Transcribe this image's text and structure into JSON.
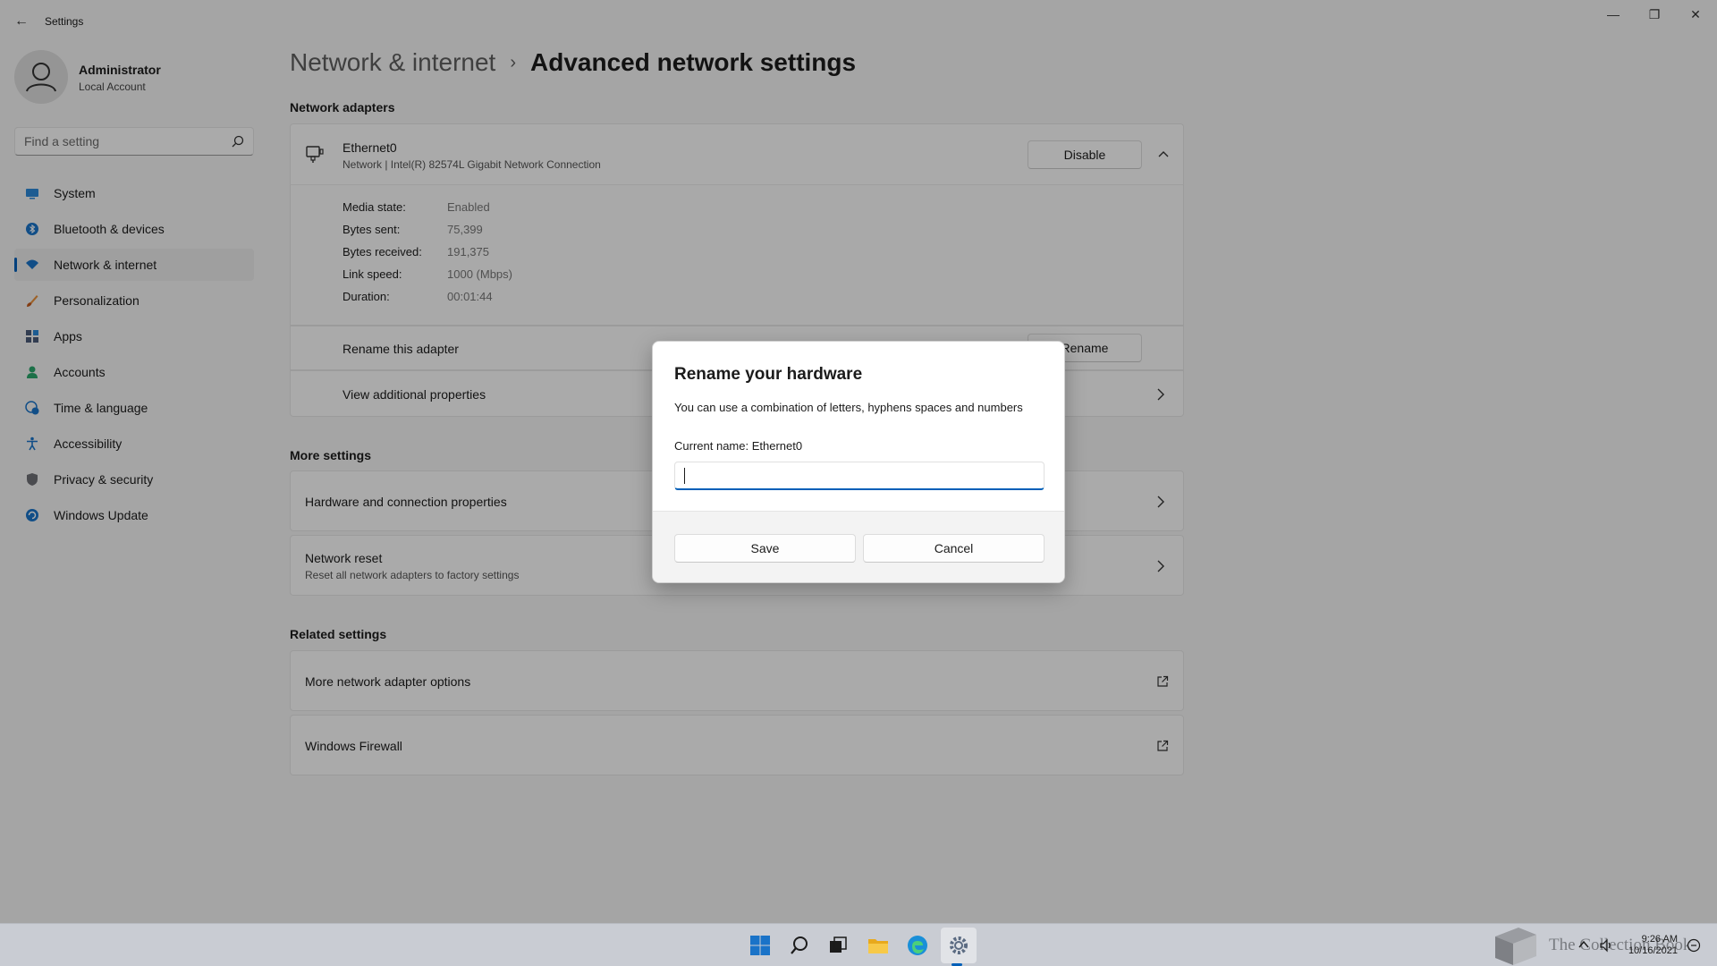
{
  "window": {
    "title": "Settings",
    "back_glyph": "←",
    "minimize_glyph": "—",
    "maximize_glyph": "❐",
    "close_glyph": "✕"
  },
  "profile": {
    "name": "Administrator",
    "account_type": "Local Account"
  },
  "search": {
    "placeholder": "Find a setting"
  },
  "sidebar": {
    "items": [
      {
        "label": "System",
        "icon": "system-icon",
        "active": false
      },
      {
        "label": "Bluetooth & devices",
        "icon": "bluetooth-icon",
        "active": false
      },
      {
        "label": "Network & internet",
        "icon": "wifi-icon",
        "active": true
      },
      {
        "label": "Personalization",
        "icon": "brush-icon",
        "active": false
      },
      {
        "label": "Apps",
        "icon": "apps-icon",
        "active": false
      },
      {
        "label": "Accounts",
        "icon": "person-icon",
        "active": false
      },
      {
        "label": "Time & language",
        "icon": "globe-clock-icon",
        "active": false
      },
      {
        "label": "Accessibility",
        "icon": "accessibility-icon",
        "active": false
      },
      {
        "label": "Privacy & security",
        "icon": "shield-icon",
        "active": false
      },
      {
        "label": "Windows Update",
        "icon": "update-icon",
        "active": false
      }
    ]
  },
  "breadcrumb": {
    "parent": "Network & internet",
    "separator": "›",
    "current": "Advanced network settings"
  },
  "network_adapters": {
    "section_title": "Network adapters",
    "adapter": {
      "name": "Ethernet0",
      "description": "Network | Intel(R) 82574L Gigabit Network Connection",
      "disable_label": "Disable",
      "details": [
        {
          "label": "Media state:",
          "value": "Enabled"
        },
        {
          "label": "Bytes sent:",
          "value": "75,399"
        },
        {
          "label": "Bytes received:",
          "value": "191,375"
        },
        {
          "label": "Link speed:",
          "value": "1000 (Mbps)"
        },
        {
          "label": "Duration:",
          "value": "00:01:44"
        }
      ],
      "rename_row_label": "Rename this adapter",
      "rename_button_label": "Rename",
      "view_properties_label": "View additional properties"
    }
  },
  "more_settings": {
    "section_title": "More settings",
    "items": [
      {
        "label": "Hardware and connection properties",
        "sub": ""
      },
      {
        "label": "Network reset",
        "sub": "Reset all network adapters to factory settings"
      }
    ]
  },
  "related_settings": {
    "section_title": "Related settings",
    "items": [
      {
        "label": "More network adapter options"
      },
      {
        "label": "Windows Firewall"
      }
    ]
  },
  "dialog": {
    "title": "Rename your hardware",
    "description": "You can use a combination of letters, hyphens spaces and numbers",
    "current_name_label": "Current name: Ethernet0",
    "input_value": "",
    "save_label": "Save",
    "cancel_label": "Cancel"
  },
  "taskbar": {
    "pinned": [
      "start-icon",
      "search-icon",
      "task-view-icon",
      "file-explorer-icon",
      "edge-icon",
      "settings-icon"
    ],
    "active": "settings-icon",
    "time": "9:26 AM",
    "date": "10/16/2021",
    "watermark": "The Collection Book"
  },
  "colors": {
    "accent": "#005fb8",
    "background": "#f3f3f3",
    "card": "#fbfbfb"
  }
}
